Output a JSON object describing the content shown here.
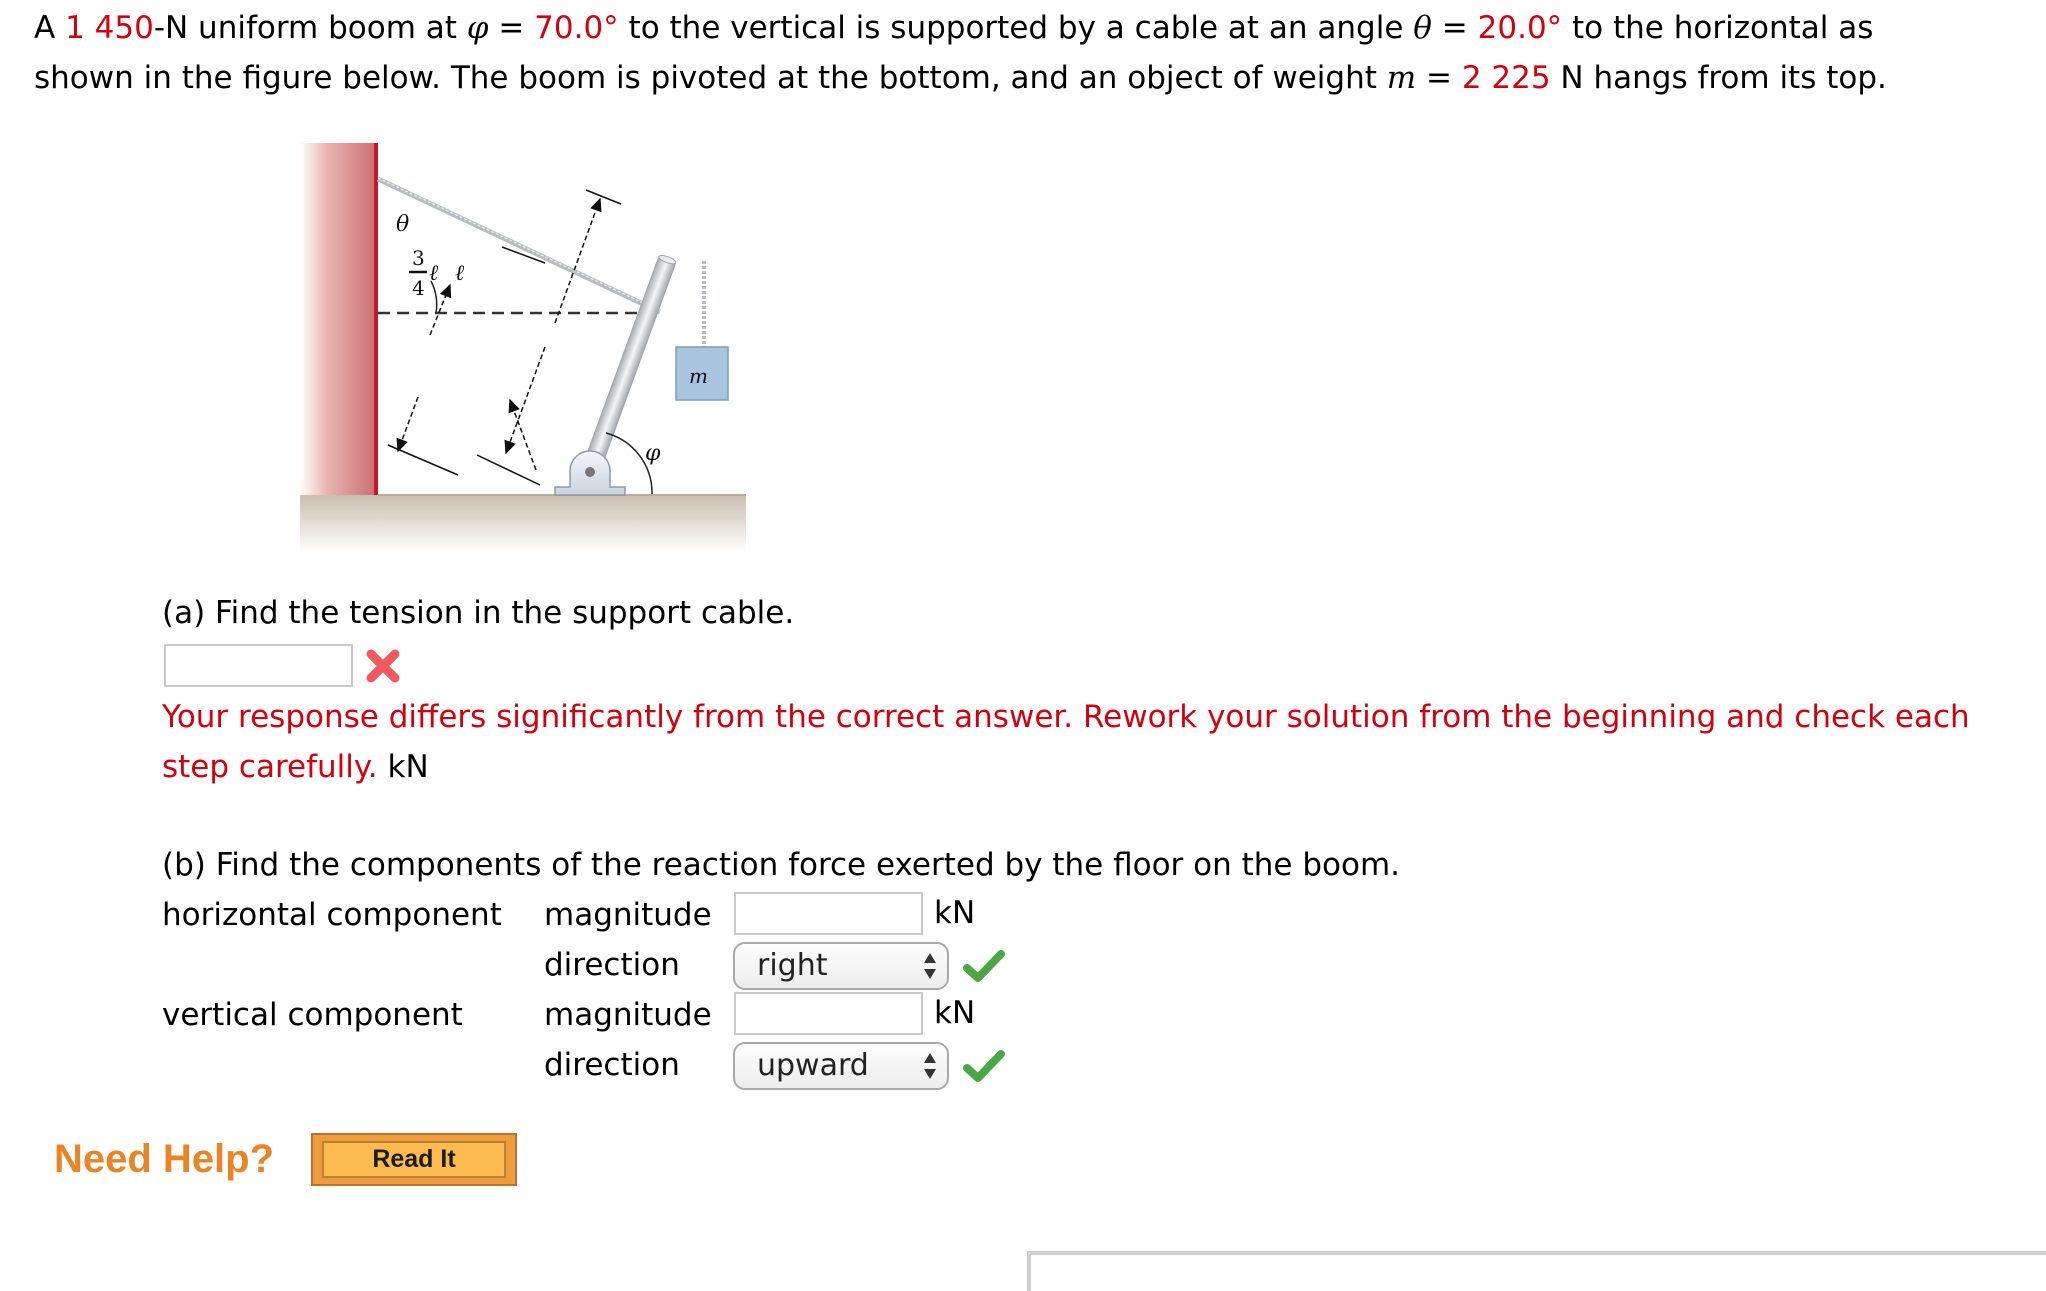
{
  "problem": {
    "line1": [
      {
        "text": "A ",
        "style": "normal"
      },
      {
        "text": "1 450",
        "style": "red"
      },
      {
        "text": "-N uniform boom at ",
        "style": "normal"
      },
      {
        "text": "φ",
        "style": "italic"
      },
      {
        "text": " = ",
        "style": "normal"
      },
      {
        "text": "70.0°",
        "style": "red"
      },
      {
        "text": " to the vertical is supported by a cable at an angle ",
        "style": "normal"
      },
      {
        "text": "θ",
        "style": "italic"
      },
      {
        "text": " = ",
        "style": "normal"
      },
      {
        "text": "20.0°",
        "style": "red"
      },
      {
        "text": " to the horizontal as",
        "style": "normal"
      }
    ],
    "line2": [
      {
        "text": "shown in the figure below. The boom is pivoted at the bottom, and an object of weight ",
        "style": "normal"
      },
      {
        "text": "m",
        "style": "italic"
      },
      {
        "text": " = ",
        "style": "normal"
      },
      {
        "text": "2 225",
        "style": "red"
      },
      {
        "text": " N hangs from its top.",
        "style": "normal"
      }
    ],
    "values": {
      "boom_weight_N": "1 450",
      "phi_deg": "70.0",
      "theta_deg": "20.0",
      "mass_weight_N": "2 225"
    }
  },
  "figure": {
    "labels": {
      "theta": "θ",
      "phi": "φ",
      "mass": "m",
      "length": "ℓ",
      "fraction_num": "3",
      "fraction_den": "4",
      "fraction_var": "ℓ"
    },
    "colors": {
      "wall": "#c86d6d",
      "wall_edge": "#c4162f",
      "floor": "#cfc4b9",
      "mass_box": "#a9c4df",
      "boom": "#d8dadc"
    }
  },
  "part_a": {
    "question": "(a) Find the tension in the support cable.",
    "input_value": "",
    "status": "incorrect",
    "status_icon": "x-mark-icon",
    "feedback_line1": "Your response differs significantly from the correct answer. Rework your solution from the beginning and check each",
    "feedback_line2": "step carefully.",
    "unit": "kN"
  },
  "part_b": {
    "question": "(b) Find the components of the reaction force exerted by the floor on the boom.",
    "horizontal": {
      "label": "horizontal component",
      "magnitude_label": "magnitude",
      "magnitude_value": "",
      "unit": "kN",
      "direction_label": "direction",
      "direction_value": "right",
      "direction_status": "correct"
    },
    "vertical": {
      "label": "vertical component",
      "magnitude_label": "magnitude",
      "magnitude_value": "",
      "unit": "kN",
      "direction_label": "direction",
      "direction_value": "upward",
      "direction_status": "correct"
    }
  },
  "help": {
    "label": "Need Help?",
    "button_label": "Read It",
    "color": "#e98524"
  },
  "status_colors": {
    "error": "#d4000f",
    "correct": "#4aa844"
  }
}
